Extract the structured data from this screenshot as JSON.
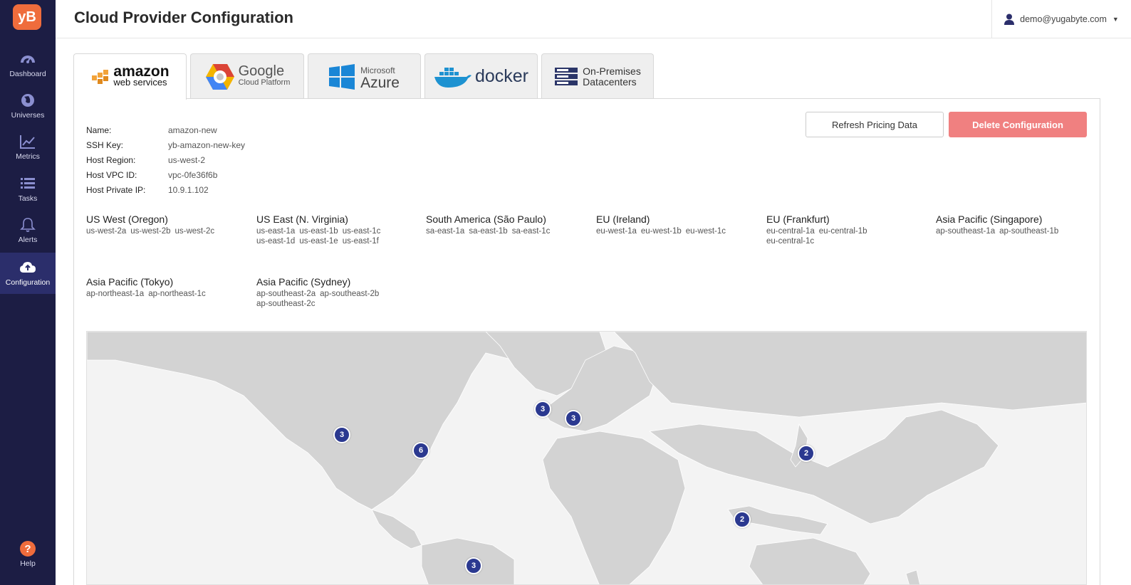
{
  "app": {
    "logo_text": "yB",
    "title": "Cloud Provider Configuration",
    "user_email": "demo@yugabyte.com"
  },
  "sidebar": {
    "items": [
      {
        "label": "Dashboard",
        "icon": "dashboard-icon"
      },
      {
        "label": "Universes",
        "icon": "globe-icon"
      },
      {
        "label": "Metrics",
        "icon": "chart-icon"
      },
      {
        "label": "Tasks",
        "icon": "list-icon"
      },
      {
        "label": "Alerts",
        "icon": "bell-icon"
      },
      {
        "label": "Configuration",
        "icon": "cloud-upload-icon",
        "active": true
      }
    ],
    "help_label": "Help",
    "help_glyph": "?"
  },
  "tabs": {
    "aws": {
      "line1": "amazon",
      "line2": "web services"
    },
    "gcp": {
      "line1": "Google",
      "line2": "Cloud Platform"
    },
    "azure": {
      "line1": "Microsoft",
      "line2": "Azure"
    },
    "docker": {
      "line1": "docker"
    },
    "onprem": {
      "line1": "On-Premises",
      "line2": "Datacenters"
    }
  },
  "actions": {
    "refresh_label": "Refresh Pricing Data",
    "delete_label": "Delete Configuration"
  },
  "details": [
    {
      "label": "Name:",
      "value": "amazon-new"
    },
    {
      "label": "SSH Key:",
      "value": "yb-amazon-new-key"
    },
    {
      "label": "Host Region:",
      "value": "us-west-2"
    },
    {
      "label": "Host VPC ID:",
      "value": "vpc-0fe36f6b"
    },
    {
      "label": "Host Private IP:",
      "value": "10.9.1.102"
    }
  ],
  "regions": [
    {
      "name": "US West (Oregon)",
      "zones": [
        "us-west-2a",
        "us-west-2b",
        "us-west-2c"
      ]
    },
    {
      "name": "US East (N. Virginia)",
      "zones": [
        "us-east-1a",
        "us-east-1b",
        "us-east-1c",
        "us-east-1d",
        "us-east-1e",
        "us-east-1f"
      ]
    },
    {
      "name": "South America (São Paulo)",
      "zones": [
        "sa-east-1a",
        "sa-east-1b",
        "sa-east-1c"
      ]
    },
    {
      "name": "EU (Ireland)",
      "zones": [
        "eu-west-1a",
        "eu-west-1b",
        "eu-west-1c"
      ]
    },
    {
      "name": "EU (Frankfurt)",
      "zones": [
        "eu-central-1a",
        "eu-central-1b",
        "eu-central-1c"
      ]
    },
    {
      "name": "Asia Pacific (Singapore)",
      "zones": [
        "ap-southeast-1a",
        "ap-southeast-1b"
      ]
    },
    {
      "name": "Asia Pacific (Tokyo)",
      "zones": [
        "ap-northeast-1a",
        "ap-northeast-1c"
      ]
    },
    {
      "name": "Asia Pacific (Sydney)",
      "zones": [
        "ap-southeast-2a",
        "ap-southeast-2b",
        "ap-southeast-2c"
      ]
    }
  ],
  "map_markers": [
    {
      "count": "3",
      "region": "US West (Oregon)"
    },
    {
      "count": "6",
      "region": "US East (N. Virginia)"
    },
    {
      "count": "3",
      "region": "EU (Ireland)"
    },
    {
      "count": "3",
      "region": "EU (Frankfurt)"
    },
    {
      "count": "2",
      "region": "Asia Pacific (Tokyo)"
    },
    {
      "count": "2",
      "region": "Asia Pacific (Singapore)"
    },
    {
      "count": "3",
      "region": "South America (São Paulo)"
    }
  ],
  "colors": {
    "sidebar_bg": "#1c1d44",
    "accent": "#ef6c3c",
    "delete_button": "#f08080",
    "marker": "#2b3990",
    "map_land": "#d3d3d3",
    "map_water": "#f3f3f3"
  }
}
